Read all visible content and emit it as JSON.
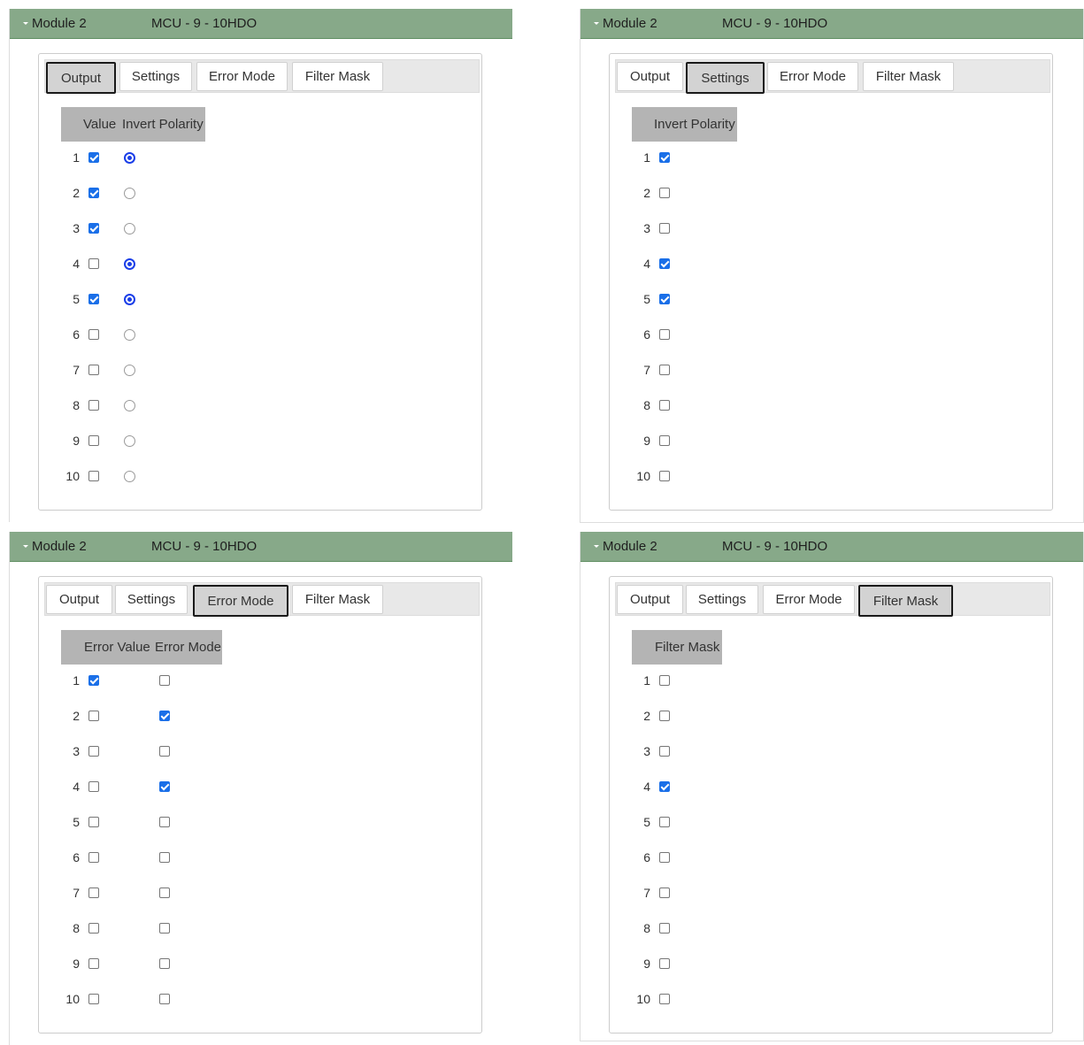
{
  "modules": [
    {
      "title": "Module 2",
      "device": "MCU - 9 - 10HDO",
      "tabs": [
        "Output",
        "Settings",
        "Error Mode",
        "Filter Mask"
      ],
      "active_tab": "Output",
      "columns": [
        "Value",
        "Invert Polarity"
      ],
      "rows": [
        {
          "n": "1",
          "value": true,
          "invert": true
        },
        {
          "n": "2",
          "value": true,
          "invert": false
        },
        {
          "n": "3",
          "value": true,
          "invert": false
        },
        {
          "n": "4",
          "value": false,
          "invert": true
        },
        {
          "n": "5",
          "value": true,
          "invert": true
        },
        {
          "n": "6",
          "value": false,
          "invert": false
        },
        {
          "n": "7",
          "value": false,
          "invert": false
        },
        {
          "n": "8",
          "value": false,
          "invert": false
        },
        {
          "n": "9",
          "value": false,
          "invert": false
        },
        {
          "n": "10",
          "value": false,
          "invert": false
        }
      ]
    },
    {
      "title": "Module 2",
      "device": "MCU - 9 - 10HDO",
      "tabs": [
        "Output",
        "Settings",
        "Error Mode",
        "Filter Mask"
      ],
      "active_tab": "Settings",
      "columns": [
        "Invert Polarity"
      ],
      "rows": [
        {
          "n": "1",
          "invert": true
        },
        {
          "n": "2",
          "invert": false
        },
        {
          "n": "3",
          "invert": false
        },
        {
          "n": "4",
          "invert": true
        },
        {
          "n": "5",
          "invert": true
        },
        {
          "n": "6",
          "invert": false
        },
        {
          "n": "7",
          "invert": false
        },
        {
          "n": "8",
          "invert": false
        },
        {
          "n": "9",
          "invert": false
        },
        {
          "n": "10",
          "invert": false
        }
      ]
    },
    {
      "title": "Module 2",
      "device": "MCU - 9 - 10HDO",
      "tabs": [
        "Output",
        "Settings",
        "Error Mode",
        "Filter Mask"
      ],
      "active_tab": "Error Mode",
      "columns": [
        "Error Value",
        "Error Mode"
      ],
      "rows": [
        {
          "n": "1",
          "error_value": true,
          "error_mode": false
        },
        {
          "n": "2",
          "error_value": false,
          "error_mode": true
        },
        {
          "n": "3",
          "error_value": false,
          "error_mode": false
        },
        {
          "n": "4",
          "error_value": false,
          "error_mode": true
        },
        {
          "n": "5",
          "error_value": false,
          "error_mode": false
        },
        {
          "n": "6",
          "error_value": false,
          "error_mode": false
        },
        {
          "n": "7",
          "error_value": false,
          "error_mode": false
        },
        {
          "n": "8",
          "error_value": false,
          "error_mode": false
        },
        {
          "n": "9",
          "error_value": false,
          "error_mode": false
        },
        {
          "n": "10",
          "error_value": false,
          "error_mode": false
        }
      ]
    },
    {
      "title": "Module 2",
      "device": "MCU - 9 - 10HDO",
      "tabs": [
        "Output",
        "Settings",
        "Error Mode",
        "Filter Mask"
      ],
      "active_tab": "Filter Mask",
      "columns": [
        "Filter Mask"
      ],
      "rows": [
        {
          "n": "1",
          "mask": false
        },
        {
          "n": "2",
          "mask": false
        },
        {
          "n": "3",
          "mask": false
        },
        {
          "n": "4",
          "mask": true
        },
        {
          "n": "5",
          "mask": false
        },
        {
          "n": "6",
          "mask": false
        },
        {
          "n": "7",
          "mask": false
        },
        {
          "n": "8",
          "mask": false
        },
        {
          "n": "9",
          "mask": false
        },
        {
          "n": "10",
          "mask": false
        }
      ]
    }
  ],
  "colors": {
    "header_green": "#87a989",
    "checkbox_blue": "#1a6fe8",
    "radio_blue": "#1a3ee8",
    "table_header_gray": "#b4b4b4"
  }
}
